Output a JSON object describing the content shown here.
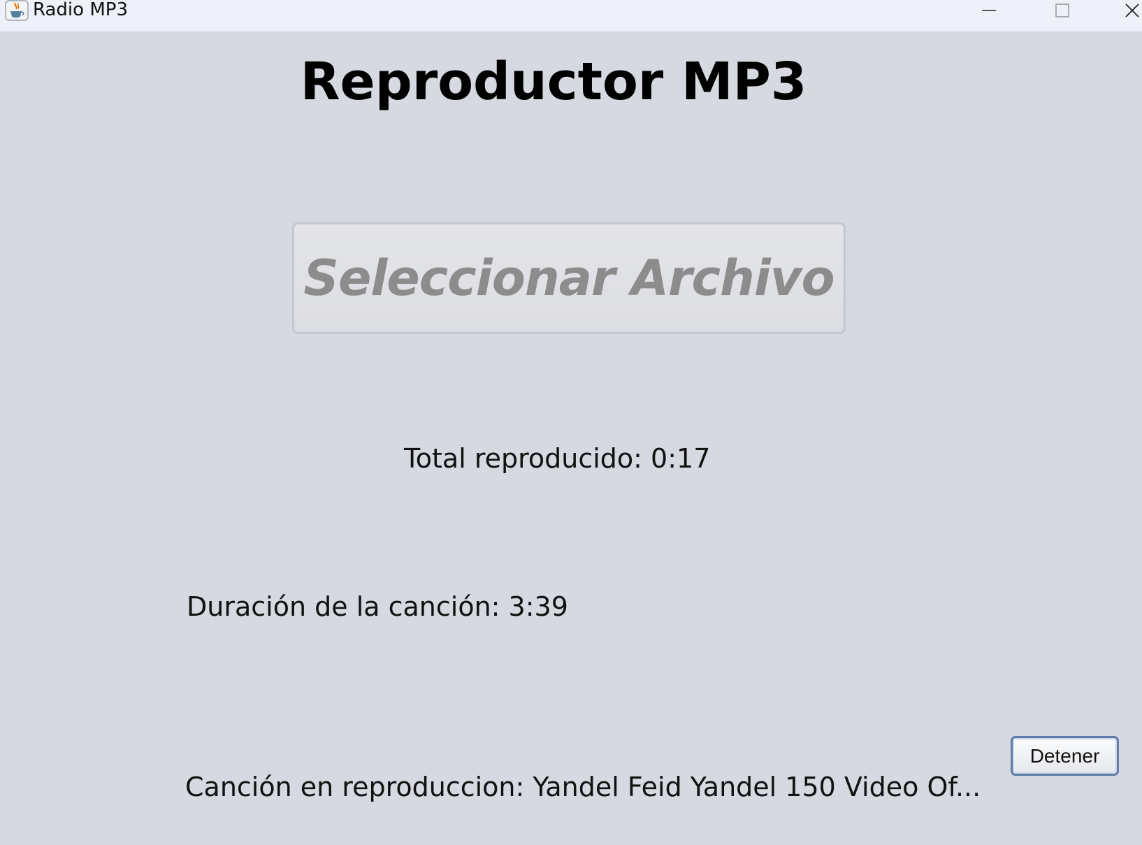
{
  "window": {
    "title": "Radio MP3",
    "app_icon": "java-cup-icon",
    "controls": {
      "minimize_icon": "minimize-icon",
      "maximize_icon": "maximize-icon",
      "close_icon": "close-icon"
    }
  },
  "main": {
    "heading": "Reproductor MP3",
    "select_button_label": "Seleccionar Archivo",
    "total_played": "Total reproducido: 0:17",
    "song_duration": "Duración de la canción:  3:39",
    "now_playing": "Canción en reproduccion: Yandel Feid   Yandel 150 Video Of...",
    "stop_button_label": "Detener"
  },
  "colors": {
    "background": "#d6d9e0",
    "titlebar": "#eef1f9",
    "select_button_text": "#8c8c8c",
    "stop_button_border": "#5f7da8"
  }
}
